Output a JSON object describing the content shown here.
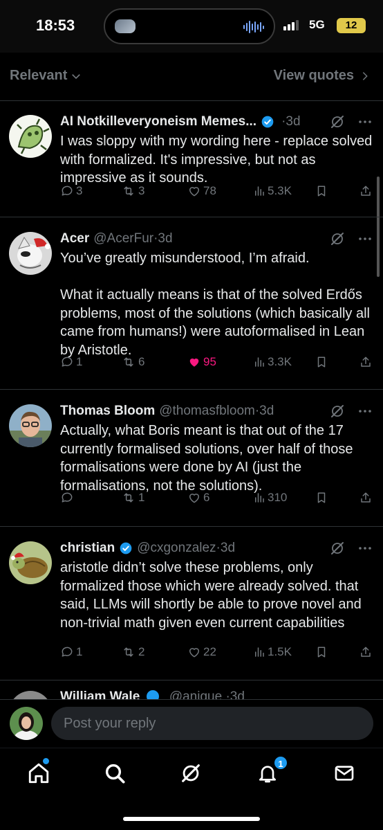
{
  "status_bar": {
    "time": "18:53",
    "network": "5G",
    "battery": "12"
  },
  "sort_bar": {
    "sort_label": "Relevant",
    "view_quotes": "View quotes"
  },
  "tweets": [
    {
      "name": "AI Notkilleveryoneism Memes...",
      "handle": "",
      "time": "·3d",
      "verified": true,
      "text": "I was sloppy with my wording here - replace solved with formalized. It's impressive, but not as impressive as it sounds.",
      "replies": "3",
      "retweets": "3",
      "likes": "78",
      "views": "5.3K",
      "liked": false
    },
    {
      "name": "Acer",
      "handle": "@AcerFur",
      "time": "·3d",
      "verified": false,
      "text": "You’ve greatly misunderstood, I’m afraid.\n\nWhat it actually means is that of the solved Erdős problems, most of the solutions (which basically all came from humans!) were autoformalised in Lean by Aristotle.",
      "replies": "1",
      "retweets": "6",
      "likes": "95",
      "views": "3.3K",
      "liked": true
    },
    {
      "name": "Thomas Bloom",
      "handle": "@thomasfbloom",
      "time": "·3d",
      "verified": false,
      "text": "Actually, what Boris meant is that out of the 17 currently formalised solutions, over half of those formalisations were done by AI (just the formalisations, not the solutions).",
      "replies": "",
      "retweets": "1",
      "likes": "6",
      "views": "310",
      "liked": false
    },
    {
      "name": "christian",
      "handle": "@cxgonzalez",
      "time": "·3d",
      "verified": true,
      "text": "aristotle didn’t solve these problems, only formalized those which were already solved. that said, LLMs will shortly be able to prove novel and non-trivial math given even current capabilities",
      "replies": "1",
      "retweets": "2",
      "likes": "22",
      "views": "1.5K",
      "liked": false
    }
  ],
  "partial_tweet": {
    "name": "William Wale",
    "handle": "@anigue",
    "time": "·3d"
  },
  "reply": {
    "placeholder": "Post your reply"
  },
  "tab_bar": {
    "notifications_badge": "1"
  },
  "colors": {
    "accent": "#1d9bf0",
    "like": "#f91880",
    "muted": "#71767b"
  }
}
